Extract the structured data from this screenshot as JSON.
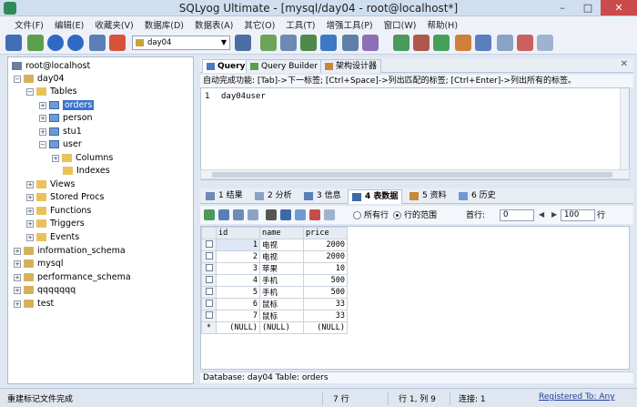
{
  "window": {
    "title": "SQLyog Ultimate - [mysql/day04 - root@localhost*]"
  },
  "menu": [
    "文件(F)",
    "编辑(E)",
    "收藏夹(V)",
    "数据库(D)",
    "数据表(A)",
    "其它(O)",
    "工具(T)",
    "增强工具(P)",
    "窗口(W)",
    "帮助(H)"
  ],
  "toolbar": {
    "database_selected": "day04"
  },
  "tree": {
    "root": "root@localhost",
    "db": "day04",
    "tables_folder": "Tables",
    "tables": [
      "orders",
      "person",
      "stu1",
      "user"
    ],
    "user_children": [
      "Columns",
      "Indexes"
    ],
    "folders": [
      "Views",
      "Stored Procs",
      "Functions",
      "Triggers",
      "Events"
    ],
    "other_dbs": [
      "information_schema",
      "mysql",
      "performance_schema",
      "qqqqqqq",
      "test"
    ]
  },
  "query_tabs": {
    "query": "Query",
    "builder": "Query Builder",
    "schema": "架构设计器"
  },
  "hint": "自动完成功能: [Tab]->下一标签; [Ctrl+Space]->列出匹配的标签; [Ctrl+Enter]->列出所有的标签。",
  "editor": {
    "line": "1",
    "code": "day04user"
  },
  "result_tabs": [
    "1 结果",
    "2 分析",
    "3 信息",
    "4 表数据",
    "5 资料",
    "6 历史"
  ],
  "result_toolbar": {
    "all_rows": "所有行",
    "row_range": "行的范围",
    "first_row_label": "首行:",
    "first_row": "0",
    "row_count": "100",
    "rows_label": "行"
  },
  "table": {
    "columns": [
      "id",
      "name",
      "price"
    ],
    "rows": [
      [
        "1",
        "电视",
        "2000"
      ],
      [
        "2",
        "电视",
        "2000"
      ],
      [
        "3",
        "苹果",
        "10"
      ],
      [
        "4",
        "手机",
        "500"
      ],
      [
        "5",
        "手机",
        "500"
      ],
      [
        "6",
        "鼠标",
        "33"
      ],
      [
        "7",
        "鼠标",
        "33"
      ]
    ],
    "new_row": [
      "(NULL)",
      "(NULL)",
      "(NULL)"
    ],
    "new_row_marker": "*"
  },
  "panel_status": "Database: day04  Table: orders",
  "status": {
    "left": "重建标记文件完成",
    "rows": "7 行",
    "cursor": "行 1, 列 9",
    "connection": "连接: 1",
    "register": "Registered To: Any"
  }
}
